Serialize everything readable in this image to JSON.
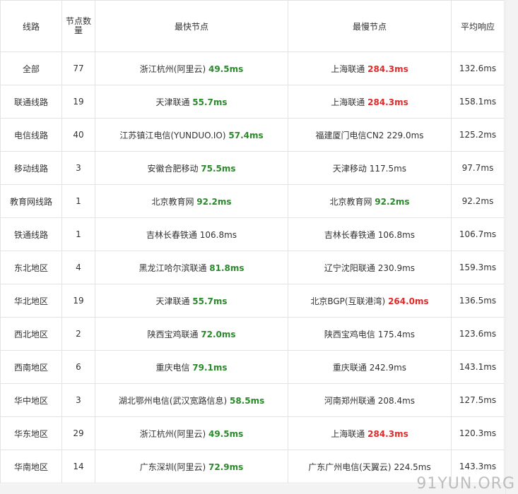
{
  "headers": {
    "route": "线路",
    "node_count": "节点数量",
    "fastest": "最快节点",
    "slowest": "最慢节点",
    "avg": "平均响应"
  },
  "rows": [
    {
      "route": "全部",
      "count": "77",
      "fast_name": "浙江杭州(阿里云)",
      "fast_ms": "49.5ms",
      "fast_style": "fast",
      "slow_name": "上海联通",
      "slow_ms": "284.3ms",
      "slow_style": "slow",
      "avg": "132.6ms"
    },
    {
      "route": "联通线路",
      "count": "19",
      "fast_name": "天津联通",
      "fast_ms": "55.7ms",
      "fast_style": "fast",
      "slow_name": "上海联通",
      "slow_ms": "284.3ms",
      "slow_style": "slow",
      "avg": "158.1ms"
    },
    {
      "route": "电信线路",
      "count": "40",
      "fast_name": "江苏镇江电信(YUNDUO.IO)",
      "fast_ms": "57.4ms",
      "fast_style": "fast",
      "slow_name": "福建厦门电信CN2",
      "slow_ms": "229.0ms",
      "slow_style": "plain",
      "avg": "125.2ms"
    },
    {
      "route": "移动线路",
      "count": "3",
      "fast_name": "安徽合肥移动",
      "fast_ms": "75.5ms",
      "fast_style": "fast",
      "slow_name": "天津移动",
      "slow_ms": "117.5ms",
      "slow_style": "plain",
      "avg": "97.7ms"
    },
    {
      "route": "教育网线路",
      "count": "1",
      "fast_name": "北京教育网",
      "fast_ms": "92.2ms",
      "fast_style": "fast",
      "slow_name": "北京教育网",
      "slow_ms": "92.2ms",
      "slow_style": "fast",
      "avg": "92.2ms"
    },
    {
      "route": "铁通线路",
      "count": "1",
      "fast_name": "吉林长春铁通",
      "fast_ms": "106.8ms",
      "fast_style": "plain",
      "slow_name": "吉林长春铁通",
      "slow_ms": "106.8ms",
      "slow_style": "plain",
      "avg": "106.7ms"
    },
    {
      "route": "东北地区",
      "count": "4",
      "fast_name": "黑龙江哈尔滨联通",
      "fast_ms": "81.8ms",
      "fast_style": "fast",
      "slow_name": "辽宁沈阳联通",
      "slow_ms": "230.9ms",
      "slow_style": "plain",
      "avg": "159.3ms"
    },
    {
      "route": "华北地区",
      "count": "19",
      "fast_name": "天津联通",
      "fast_ms": "55.7ms",
      "fast_style": "fast",
      "slow_name": "北京BGP(互联港湾)",
      "slow_ms": "264.0ms",
      "slow_style": "slow",
      "avg": "136.5ms"
    },
    {
      "route": "西北地区",
      "count": "2",
      "fast_name": "陕西宝鸡联通",
      "fast_ms": "72.0ms",
      "fast_style": "fast",
      "slow_name": "陕西宝鸡电信",
      "slow_ms": "175.4ms",
      "slow_style": "plain",
      "avg": "123.6ms"
    },
    {
      "route": "西南地区",
      "count": "6",
      "fast_name": "重庆电信",
      "fast_ms": "79.1ms",
      "fast_style": "fast",
      "slow_name": "重庆联通",
      "slow_ms": "242.9ms",
      "slow_style": "plain",
      "avg": "143.1ms"
    },
    {
      "route": "华中地区",
      "count": "3",
      "fast_name": "湖北鄂州电信(武汉宽路信息)",
      "fast_ms": "58.5ms",
      "fast_style": "fast",
      "slow_name": "河南郑州联通",
      "slow_ms": "208.4ms",
      "slow_style": "plain",
      "avg": "127.5ms"
    },
    {
      "route": "华东地区",
      "count": "29",
      "fast_name": "浙江杭州(阿里云)",
      "fast_ms": "49.5ms",
      "fast_style": "fast",
      "slow_name": "上海联通",
      "slow_ms": "284.3ms",
      "slow_style": "slow",
      "avg": "120.3ms"
    },
    {
      "route": "华南地区",
      "count": "14",
      "fast_name": "广东深圳(阿里云)",
      "fast_ms": "72.9ms",
      "fast_style": "fast",
      "slow_name": "广东广州电信(天翼云)",
      "slow_ms": "224.5ms",
      "slow_style": "plain",
      "avg": "143.3ms"
    }
  ],
  "colors": {
    "fast": "#2a8a2a",
    "slow": "#e02a2a",
    "border": "#e3e3e3"
  },
  "watermark": "91YUN.ORG"
}
